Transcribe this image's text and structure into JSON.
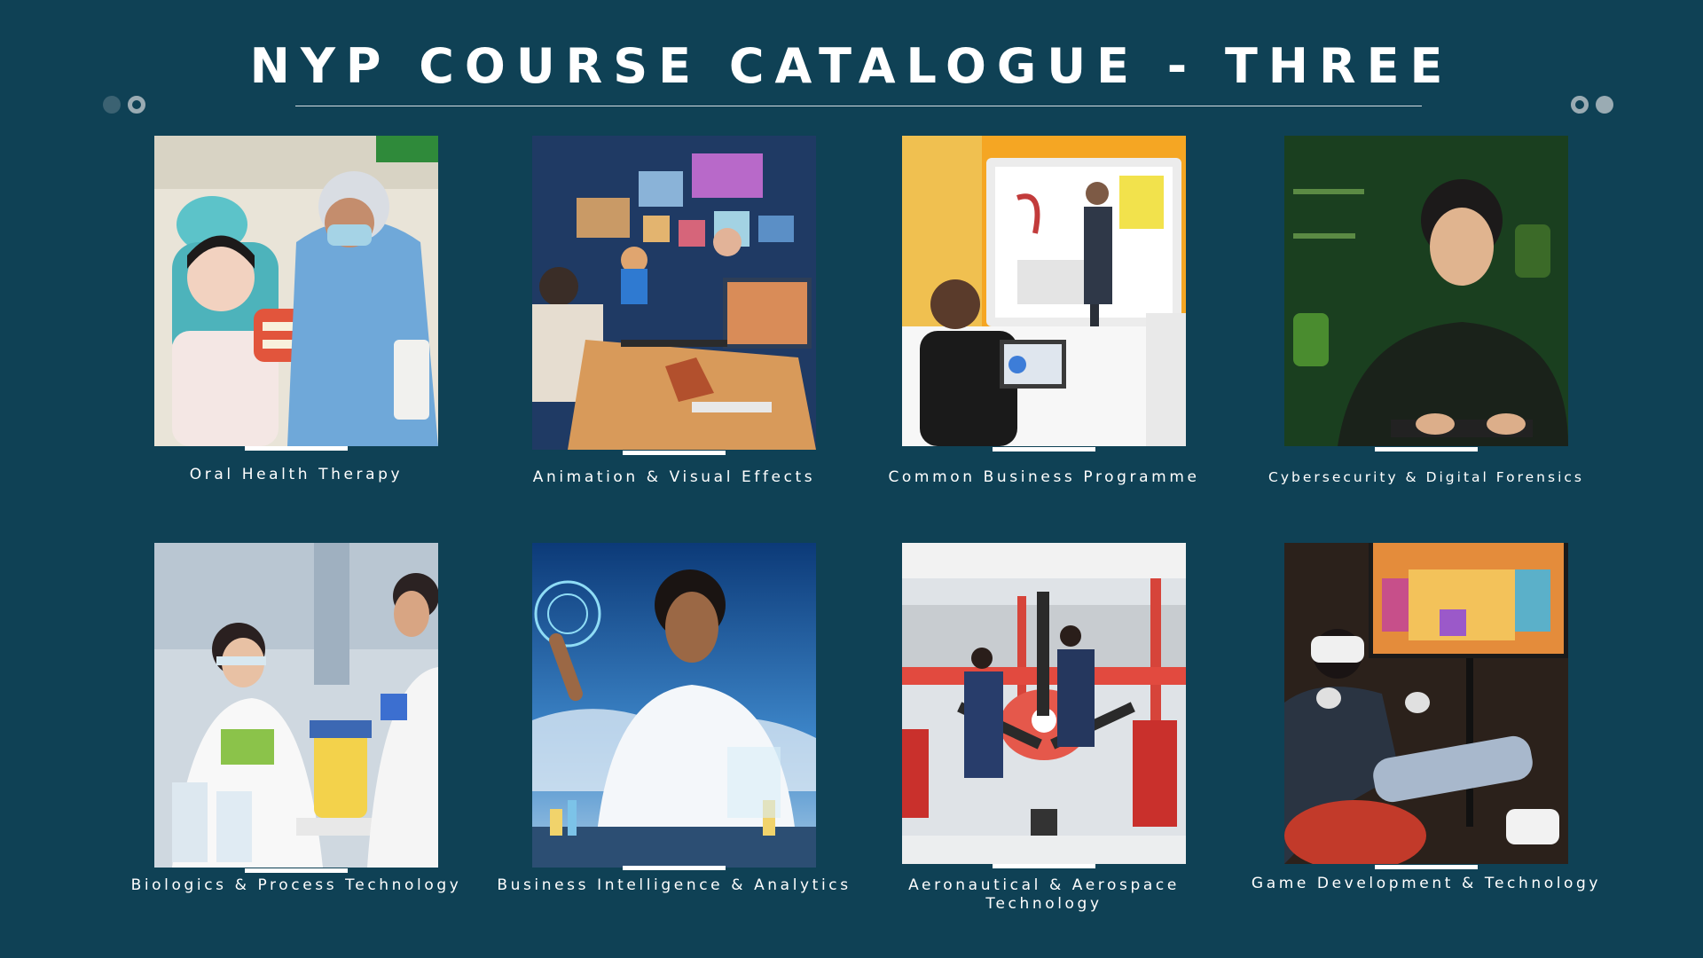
{
  "page": {
    "title": "NYP COURSE CATALOGUE - THREE"
  },
  "courses": [
    {
      "label": "Oral Health Therapy",
      "image": "dental-nurse-with-child"
    },
    {
      "label": "Animation & Visual Effects",
      "image": "animator-at-desk"
    },
    {
      "label": "Common Business Programme",
      "image": "business-presentation"
    },
    {
      "label": "Cybersecurity & Digital Forensics",
      "image": "cybersecurity-student"
    },
    {
      "label": "Biologics & Process Technology",
      "image": "lab-scientists"
    },
    {
      "label": "Business Intelligence & Analytics",
      "image": "analytics-hologram"
    },
    {
      "label": "Aeronautical & Aerospace Technology",
      "image": "aircraft-engineers"
    },
    {
      "label": "Game Development & Technology",
      "image": "vr-gamer"
    }
  ],
  "colors": {
    "background": "#0f4155",
    "text": "#ffffff",
    "accent": "#9aabb3"
  }
}
